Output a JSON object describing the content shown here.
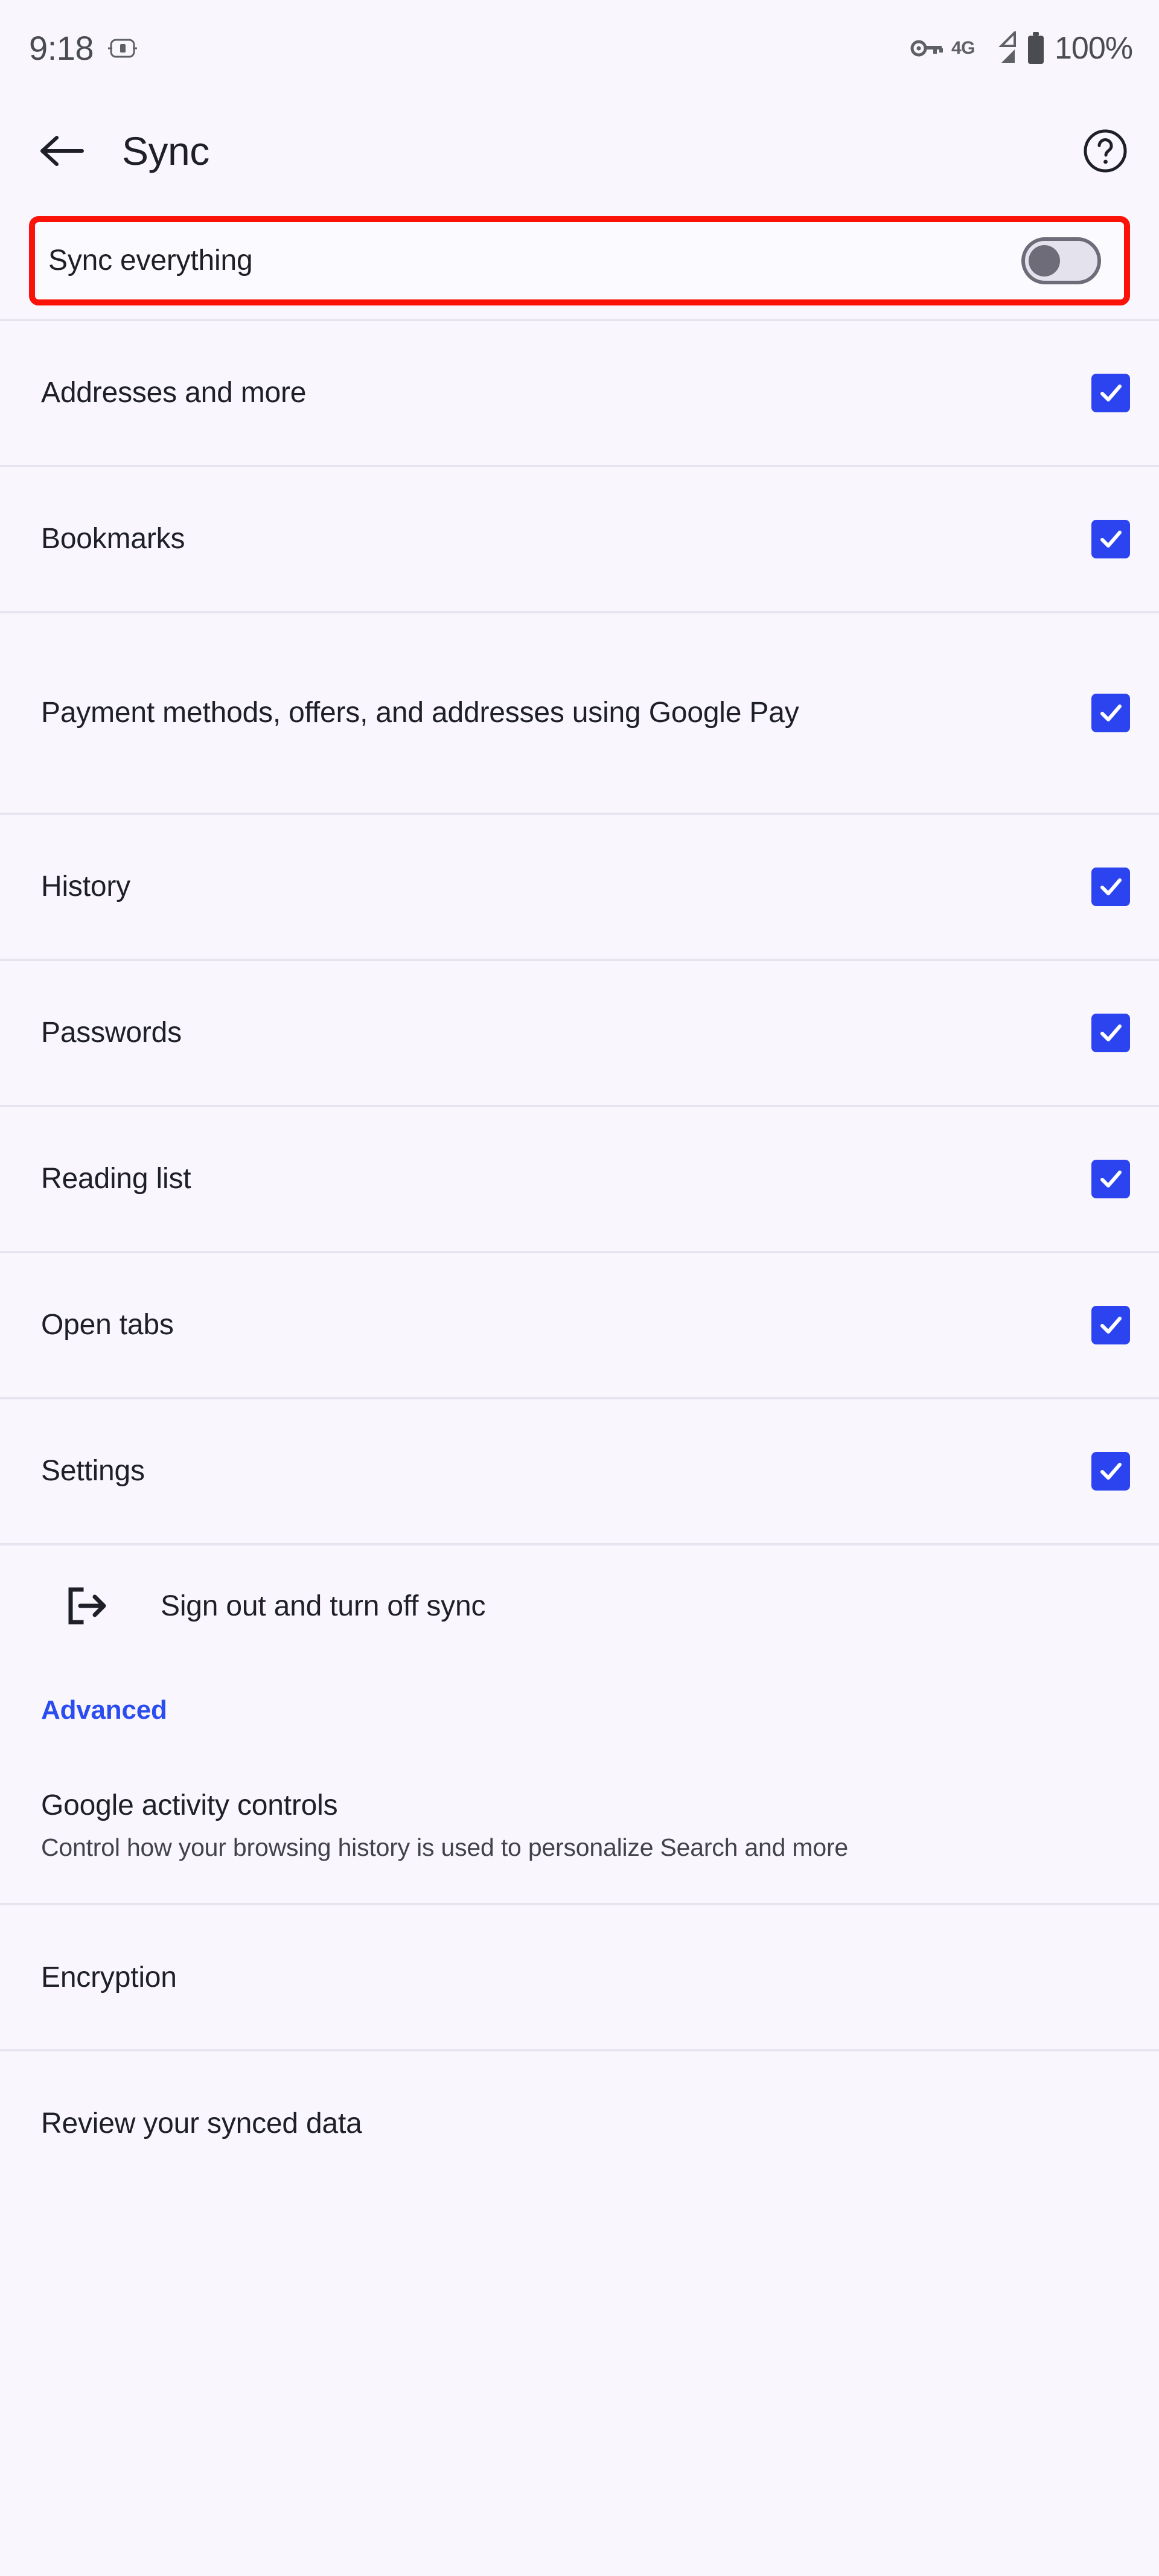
{
  "status_bar": {
    "time": "9:18",
    "notification_icon": "card-reader-icon",
    "vpn_icon": "vpn-key-icon",
    "network_type": "4G",
    "signal_icon": "signal-bars-icon",
    "battery_icon": "battery-full-icon",
    "battery_level": "100%"
  },
  "app_bar": {
    "back_icon": "arrow-back-icon",
    "title": "Sync",
    "help_icon": "help-circle-icon"
  },
  "sync_everything": {
    "label": "Sync everything",
    "toggle_state": "off",
    "highlight_color": "#fb1208"
  },
  "data_types": [
    {
      "label": "Addresses and more",
      "checked": true
    },
    {
      "label": "Bookmarks",
      "checked": true
    },
    {
      "label": "Payment methods, offers, and addresses using Google Pay",
      "checked": true
    },
    {
      "label": "History",
      "checked": true
    },
    {
      "label": "Passwords",
      "checked": true
    },
    {
      "label": "Reading list",
      "checked": true
    },
    {
      "label": "Open tabs",
      "checked": true
    },
    {
      "label": "Settings",
      "checked": true
    }
  ],
  "sign_out": {
    "icon": "logout-icon",
    "label": "Sign out and turn off sync"
  },
  "advanced": {
    "header": "Advanced",
    "activity_controls": {
      "title": "Google activity controls",
      "subtitle": "Control how your browsing history is used to personalize Search and more"
    },
    "encryption": {
      "label": "Encryption"
    },
    "review_synced_data": {
      "label": "Review your synced data"
    }
  },
  "colors": {
    "background": "#f9f7fd",
    "checkbox_blue": "#2b44f0",
    "accent_blue": "#2b4df0",
    "divider": "#e6e4ee",
    "text_primary": "#1f1f27",
    "text_secondary": "#42424a"
  }
}
